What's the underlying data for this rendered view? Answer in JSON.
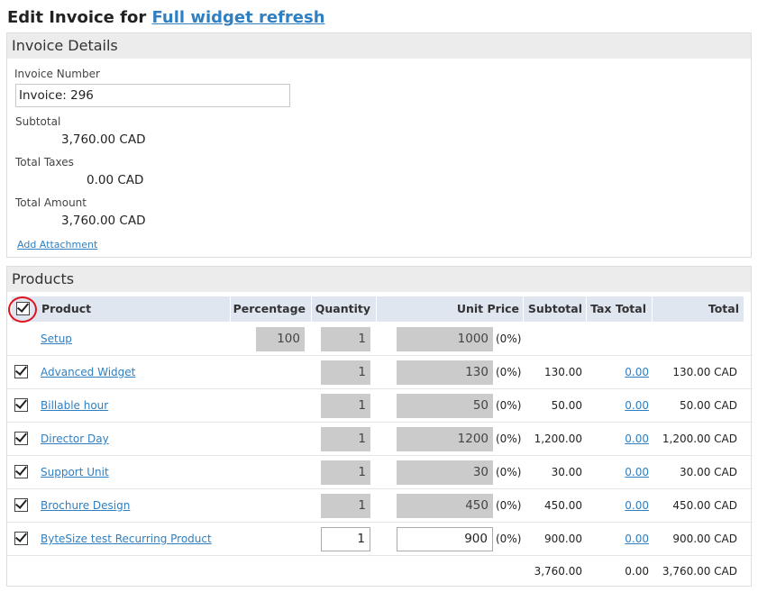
{
  "page": {
    "title_prefix": "Edit Invoice for",
    "title_link": "Full widget refresh"
  },
  "invoice_details": {
    "header": "Invoice Details",
    "invoice_number_label": "Invoice Number",
    "invoice_number_value": "Invoice: 296",
    "subtotal_label": "Subtotal",
    "subtotal_value": "3,760.00 CAD",
    "total_taxes_label": "Total Taxes",
    "total_taxes_value": "0.00 CAD",
    "total_amount_label": "Total Amount",
    "total_amount_value": "3,760.00 CAD",
    "add_attachment": "Add Attachment"
  },
  "products": {
    "header": "Products",
    "columns": {
      "product": "Product",
      "percentage": "Percentage",
      "quantity": "Quantity",
      "unit_price": "Unit Price",
      "subtotal": "Subtotal",
      "tax_total": "Tax Total",
      "total": "Total"
    },
    "rows": [
      {
        "name": "Setup",
        "checked": false,
        "percentage": "100",
        "quantity": "1",
        "unit_price": "1000",
        "pct": "(0%)",
        "subtotal": "",
        "tax_total": "",
        "total": "",
        "editable": false
      },
      {
        "name": "Advanced Widget",
        "checked": true,
        "percentage": "",
        "quantity": "1",
        "unit_price": "130",
        "pct": "(0%)",
        "subtotal": "130.00",
        "tax_total": "0.00",
        "total": "130.00 CAD",
        "editable": false
      },
      {
        "name": "Billable hour",
        "checked": true,
        "percentage": "",
        "quantity": "1",
        "unit_price": "50",
        "pct": "(0%)",
        "subtotal": "50.00",
        "tax_total": "0.00",
        "total": "50.00 CAD",
        "editable": false
      },
      {
        "name": "Director Day",
        "checked": true,
        "percentage": "",
        "quantity": "1",
        "unit_price": "1200",
        "pct": "(0%)",
        "subtotal": "1,200.00",
        "tax_total": "0.00",
        "total": "1,200.00 CAD",
        "editable": false
      },
      {
        "name": "Support Unit",
        "checked": true,
        "percentage": "",
        "quantity": "1",
        "unit_price": "30",
        "pct": "(0%)",
        "subtotal": "30.00",
        "tax_total": "0.00",
        "total": "30.00 CAD",
        "editable": false
      },
      {
        "name": "Brochure Design",
        "checked": true,
        "percentage": "",
        "quantity": "1",
        "unit_price": "450",
        "pct": "(0%)",
        "subtotal": "450.00",
        "tax_total": "0.00",
        "total": "450.00 CAD",
        "editable": false
      },
      {
        "name": "ByteSize test Recurring Product",
        "checked": true,
        "percentage": "",
        "quantity": "1",
        "unit_price": "900",
        "pct": "(0%)",
        "subtotal": "900.00",
        "tax_total": "0.00",
        "total": "900.00 CAD",
        "editable": true
      }
    ],
    "totals": {
      "subtotal": "3,760.00",
      "tax_total": "0.00",
      "total": "3,760.00 CAD"
    }
  },
  "colors": {
    "link": "#2f7fc1",
    "header_bg": "#dfe6f0",
    "highlight_circle": "#e0141e",
    "readonly_box": "#cbcbcb"
  }
}
